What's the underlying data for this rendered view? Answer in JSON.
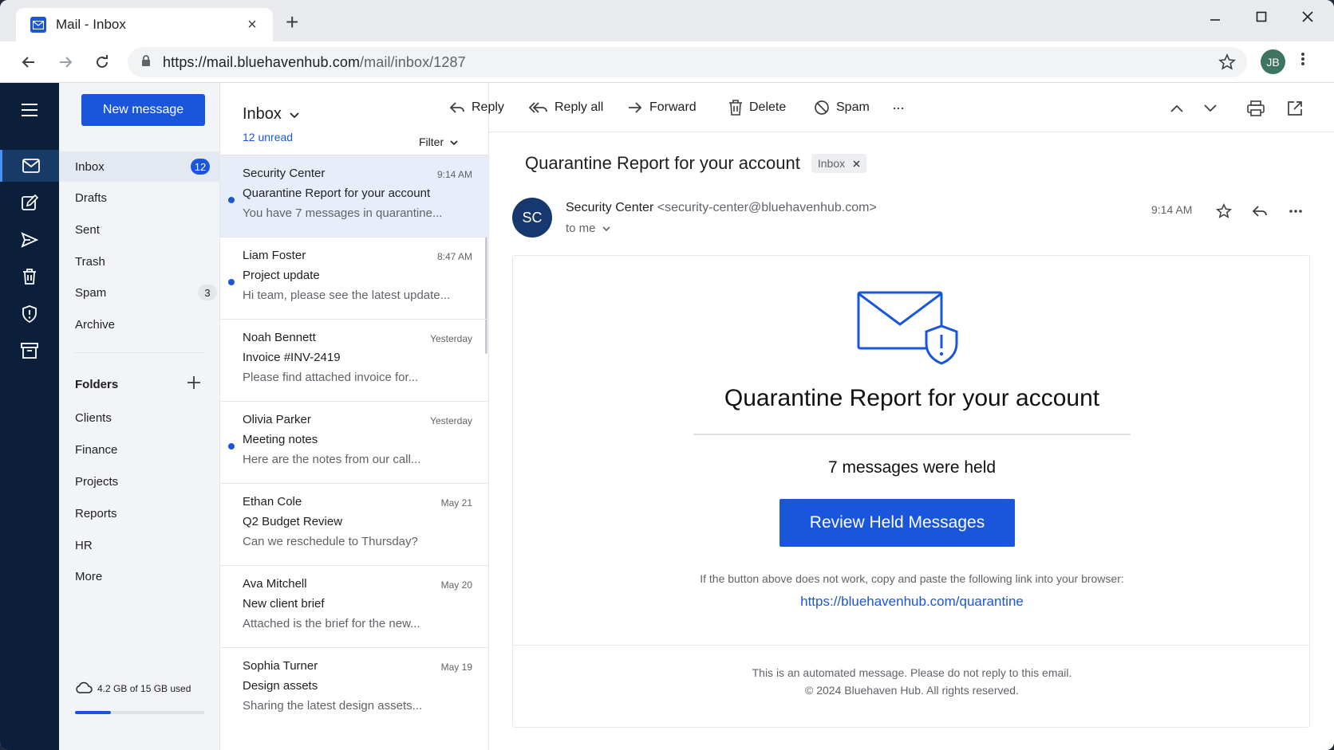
{
  "browser": {
    "tab_title": "Mail - Inbox",
    "tab_close": "×",
    "new_tab": "+",
    "url_host": "https://mail.bluehavenhub.com",
    "url_path": "/mail/inbox/1287",
    "profile_initials": "JB"
  },
  "folder_pane": {
    "new_message_label": "New message",
    "items": [
      {
        "label": "Inbox",
        "count": "12"
      },
      {
        "label": "Drafts"
      },
      {
        "label": "Sent"
      },
      {
        "label": "Trash"
      },
      {
        "label": "Spam",
        "count": "3"
      },
      {
        "label": "Archive"
      }
    ],
    "folders_heading": "Folders",
    "folders": [
      "Clients",
      "Finance",
      "Projects",
      "Reports",
      "HR",
      "More"
    ],
    "storage_label": "4.2 GB of 15 GB used",
    "storage_fraction": 0.28
  },
  "message_list": {
    "title": "Inbox",
    "unread_label": "12 unread",
    "filter_label": "Filter",
    "messages": [
      {
        "from": "Security Center",
        "time": "9:14 AM",
        "subject": "Quarantine Report for your account",
        "preview": "You have 7 messages in quarantine...",
        "unread": true,
        "selected": true
      },
      {
        "from": "Liam Foster",
        "time": "8:47 AM",
        "subject": "Project update",
        "preview": "Hi team, please see the latest update...",
        "unread": true
      },
      {
        "from": "Noah Bennett",
        "time": "Yesterday",
        "subject": "Invoice #INV-2419",
        "preview": "Please find attached invoice for...",
        "unread": false
      },
      {
        "from": "Olivia Parker",
        "time": "Yesterday",
        "subject": "Meeting notes",
        "preview": "Here are the notes from our call...",
        "unread": true
      },
      {
        "from": "Ethan Cole",
        "time": "May 21",
        "subject": "Q2 Budget Review",
        "preview": "Can we reschedule to Thursday?",
        "unread": false
      },
      {
        "from": "Ava Mitchell",
        "time": "May 20",
        "subject": "New client brief",
        "preview": "Attached is the brief for the new...",
        "unread": false
      },
      {
        "from": "Sophia Turner",
        "time": "May 19",
        "subject": "Design assets",
        "preview": "Sharing the latest design assets...",
        "unread": false
      }
    ]
  },
  "reader_toolbar": {
    "reply": "Reply",
    "reply_all": "Reply all",
    "forward": "Forward",
    "delete": "Delete",
    "spam": "Spam",
    "more": "···"
  },
  "email": {
    "subject": "Quarantine Report for your account",
    "label_chip": "Inbox",
    "avatar_initials": "SC",
    "sender_name": "Security Center",
    "sender_address": "<security-center@bluehavenhub.com>",
    "recipient": "to me",
    "time": "9:14 AM",
    "body": {
      "heading": "Quarantine Report for your account",
      "held_text": "7 messages were held",
      "cta_label": "Review Held Messages",
      "fallback_text": "If the button above does not work, copy and paste the following link into your browser:",
      "fallback_link": "https://bluehavenhub.com/quarantine",
      "footer_line1": "This is an automated message. Please do not reply to this email.",
      "footer_line2": "© 2024 Bluehaven Hub. All rights reserved."
    }
  },
  "colors": {
    "accent": "#1a56db",
    "rail": "#0b1f3a",
    "avatar": "#17386e"
  }
}
